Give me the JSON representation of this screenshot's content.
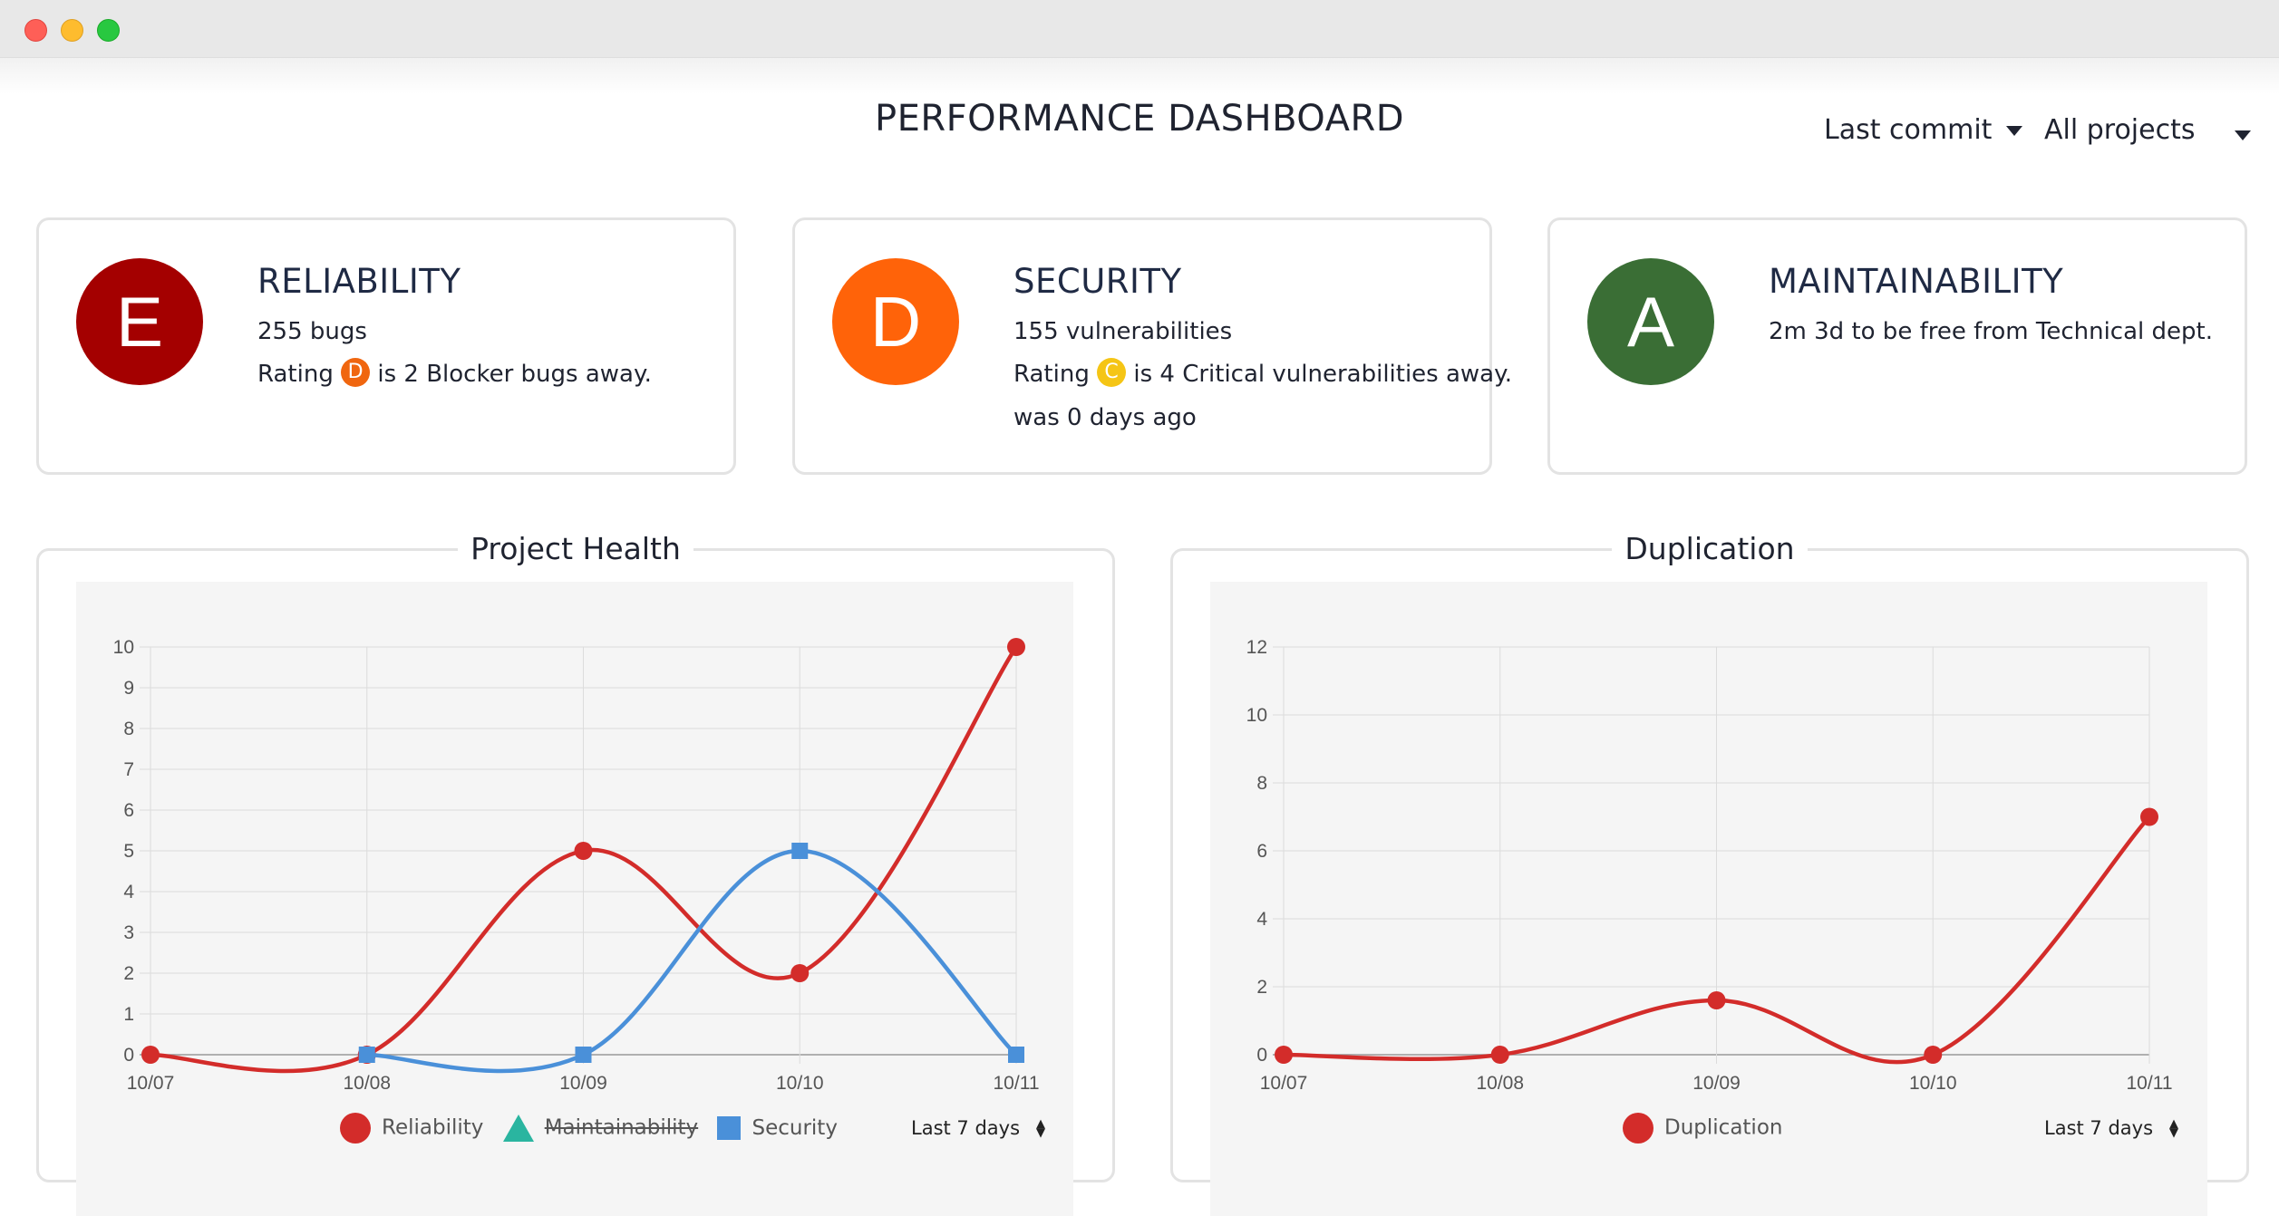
{
  "header": {
    "title": "PERFORMANCE DASHBOARD"
  },
  "filters": {
    "commit": "Last commit",
    "projects": "All projects"
  },
  "cards": {
    "reliability": {
      "grade": "E",
      "grade_color": "#a40000",
      "title": "RELIABILITY",
      "line1": "255 bugs",
      "line2_prefix": "Rating",
      "badge": "D",
      "badge_color": "#f0660f",
      "line2_suffix": "is 2 Blocker bugs away."
    },
    "security": {
      "grade": "D",
      "grade_color": "#ff6309",
      "title": "SECURITY",
      "line1": "155 vulnerabilities",
      "line2_prefix": "Rating",
      "badge": "C",
      "badge_color": "#f5c515",
      "line2_suffix": "is 4 Critical vulnerabilities away.",
      "line3": "was 0 days ago"
    },
    "maintainability": {
      "grade": "A",
      "grade_color": "#3a6e35",
      "title": "MAINTAINABILITY",
      "line1": "2m 3d to be free from Technical dept."
    }
  },
  "panels": {
    "health": {
      "title": "Project Health",
      "range": "Last 7 days"
    },
    "duplication": {
      "title": "Duplication",
      "range": "Last 7 days"
    }
  },
  "chart_data": [
    {
      "type": "line",
      "title": "Project Health",
      "x": [
        "10/07",
        "10/08",
        "10/09",
        "10/10",
        "10/11"
      ],
      "ylim": [
        0,
        10
      ],
      "yticks": [
        0,
        1,
        2,
        3,
        4,
        5,
        6,
        7,
        8,
        9,
        10
      ],
      "grid": true,
      "legend": "bottom",
      "series": [
        {
          "name": "Reliability",
          "values": [
            0,
            0,
            5,
            2,
            10
          ],
          "color": "#d32c2a",
          "marker": "circle",
          "hidden": false
        },
        {
          "name": "Maintainability",
          "values": [],
          "color": "#2ab5a0",
          "marker": "triangle",
          "hidden": true
        },
        {
          "name": "Security",
          "values": [
            null,
            0,
            0,
            5,
            0
          ],
          "color": "#4a90d9",
          "marker": "square",
          "hidden": false
        }
      ]
    },
    {
      "type": "line",
      "title": "Duplication",
      "x": [
        "10/07",
        "10/08",
        "10/09",
        "10/10",
        "10/11"
      ],
      "ylim": [
        0,
        12
      ],
      "yticks": [
        0,
        2,
        4,
        6,
        8,
        10,
        12
      ],
      "grid": true,
      "legend": "bottom",
      "series": [
        {
          "name": "Duplication",
          "values": [
            0,
            0,
            1.6,
            0,
            7
          ],
          "color": "#d32c2a",
          "marker": "circle",
          "hidden": false
        }
      ]
    }
  ]
}
